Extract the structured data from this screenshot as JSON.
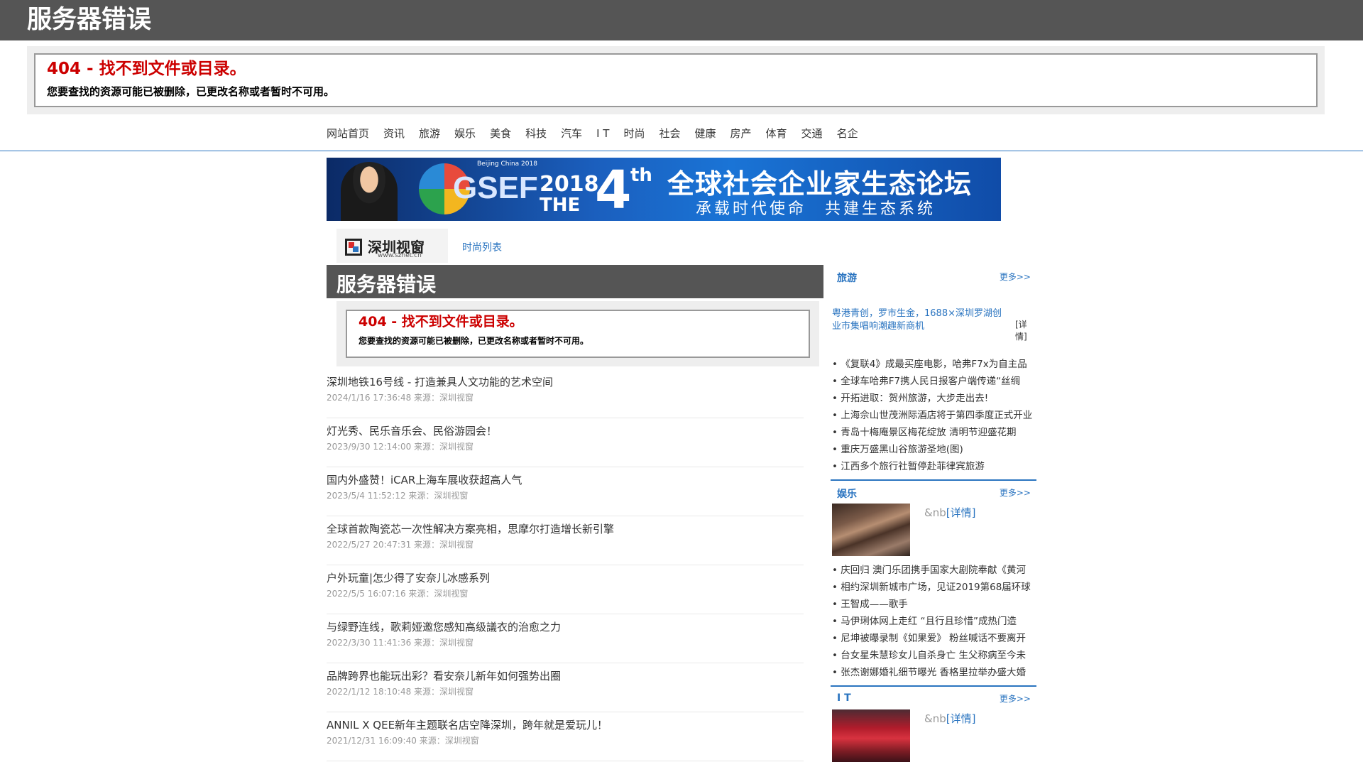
{
  "header": {
    "title": "服务器错误"
  },
  "error": {
    "title": "404 - 找不到文件或目录。",
    "description": "您要查找的资源可能已被删除，已更改名称或者暂时不可用。"
  },
  "nav": {
    "items": [
      "网站首页",
      "资讯",
      "旅游",
      "娱乐",
      "美食",
      "科技",
      "汽车",
      "I T",
      "时尚",
      "社会",
      "健康",
      "房产",
      "体育",
      "交通",
      "名企"
    ]
  },
  "banner": {
    "title": "全球社会企业家生态论坛",
    "slogan": "承载时代使命　共建生态系统",
    "logo_text": "GSEF",
    "logo_sub": "Beijing China 2018",
    "year": "2018",
    "the": "THE",
    "ordinal": "4",
    "ordinal_suffix": "th"
  },
  "site_logo": {
    "name": "深圳视窗",
    "url": "www.sznet.cn"
  },
  "breadcrumb": "时尚列表",
  "main": {
    "header_title": "服务器错误",
    "error_title": "404 - 找不到文件或目录。",
    "error_description": "您要查找的资源可能已被删除，已更改名称或者暂时不可用。",
    "news": [
      {
        "title": "深圳地铁16号线 - 打造兼具人文功能的艺术空间",
        "meta": "2024/1/16 17:36:48 来源：深圳视窗"
      },
      {
        "title": "灯光秀、民乐音乐会、民俗游园会！",
        "meta": "2023/9/30 12:14:00 来源：深圳视窗"
      },
      {
        "title": "国内外盛赞！iCAR上海车展收获超高人气",
        "meta": "2023/5/4 11:52:12 来源：深圳视窗"
      },
      {
        "title": "全球首款陶瓷芯一次性解决方案亮相，思摩尔打造增长新引擎",
        "meta": "2022/5/27 20:47:31 来源：深圳视窗"
      },
      {
        "title": "户外玩童|怎少得了安奈儿冰感系列",
        "meta": "2022/5/5 16:07:16 来源：深圳视窗"
      },
      {
        "title": "与绿野连线，歌莉娅邀您感知高级議衣的治愈之力",
        "meta": "2022/3/30 11:41:36 来源：深圳视窗"
      },
      {
        "title": "品牌跨界也能玩出彩？看安奈儿新年如何强势出圈",
        "meta": "2022/1/12 18:10:48 来源：深圳视窗"
      },
      {
        "title": "ANNIL X QEE新年主题联名店空降深圳，跨年就是爱玩儿！",
        "meta": "2021/12/31 16:09:40 来源：深圳视窗"
      }
    ]
  },
  "sidebar": {
    "more_label": "更多>>",
    "travel": {
      "label": "旅游",
      "image_alt": "粤港青创，罗市生金，1688×深圳罗湖创业市集唱响潮趣新商机",
      "detail_label": "[详情]",
      "items": [
        "《复联4》成最买座电影，哈弗F7x为自主品",
        "全球车哈弗F7携人民日报客户端传递“丝绸",
        "开拓进取：贺州旅游，大步走出去!",
        "上海佘山世茂洲际酒店将于第四季度正式开业",
        "青岛十梅庵景区梅花绽放 清明节迎盛花期",
        "重庆万盛黑山谷旅游圣地(图)",
        "江西多个旅行社暂停赴菲律宾旅游"
      ]
    },
    "entertainment": {
      "label": "娱乐",
      "nb_text": "&nb",
      "detail_label": "[详情]",
      "items": [
        "庆回归 澳门乐团携手国家大剧院奉献《黄河",
        "相约深圳新城市广场，见证2019第68届环球",
        "王智成——歌手",
        "马伊琍体网上走红 “且行且珍惜”成热门造",
        "尼坤被曝录制《如果爱》 粉丝喊话不要离开",
        "台女星朱慧珍女儿自杀身亡 生父称病至今未",
        "张杰谢娜婚礼细节曝光 香格里拉举办盛大婚"
      ]
    },
    "it": {
      "label": "I T",
      "nb_text": "&nb",
      "detail_label": "[详情]"
    }
  }
}
